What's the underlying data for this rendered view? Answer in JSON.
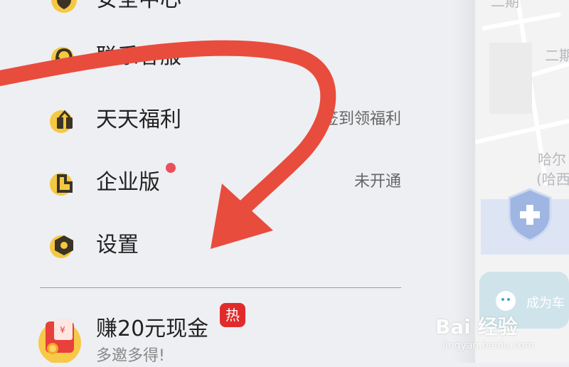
{
  "menu": {
    "items": [
      {
        "label": "安全中心",
        "right": "",
        "icon": "shield-icon"
      },
      {
        "label": "联系客服",
        "right": "",
        "icon": "headset-icon"
      },
      {
        "label": "天天福利",
        "right": "签到领福利",
        "icon": "gift-icon"
      },
      {
        "label": "企业版",
        "right": "未开通",
        "icon": "building-icon"
      },
      {
        "label": "设置",
        "right": "",
        "icon": "gear-icon"
      }
    ]
  },
  "promo": {
    "title": "赚20元现金",
    "badge": "热",
    "subtitle": "多邀多得!",
    "icon": "red-envelope-icon"
  },
  "map": {
    "labels": [
      "二期",
      "二期",
      "哈尔",
      "(哈西"
    ],
    "banner_text": "成为车"
  },
  "watermark": {
    "text": "Bai 经验",
    "sub": "jingyan.baidu.com"
  },
  "colors": {
    "accent_yellow": "#f5c842",
    "arrow_red": "#e84c3d",
    "hot_red": "#e02b2b",
    "dot_red": "#e8505b"
  }
}
